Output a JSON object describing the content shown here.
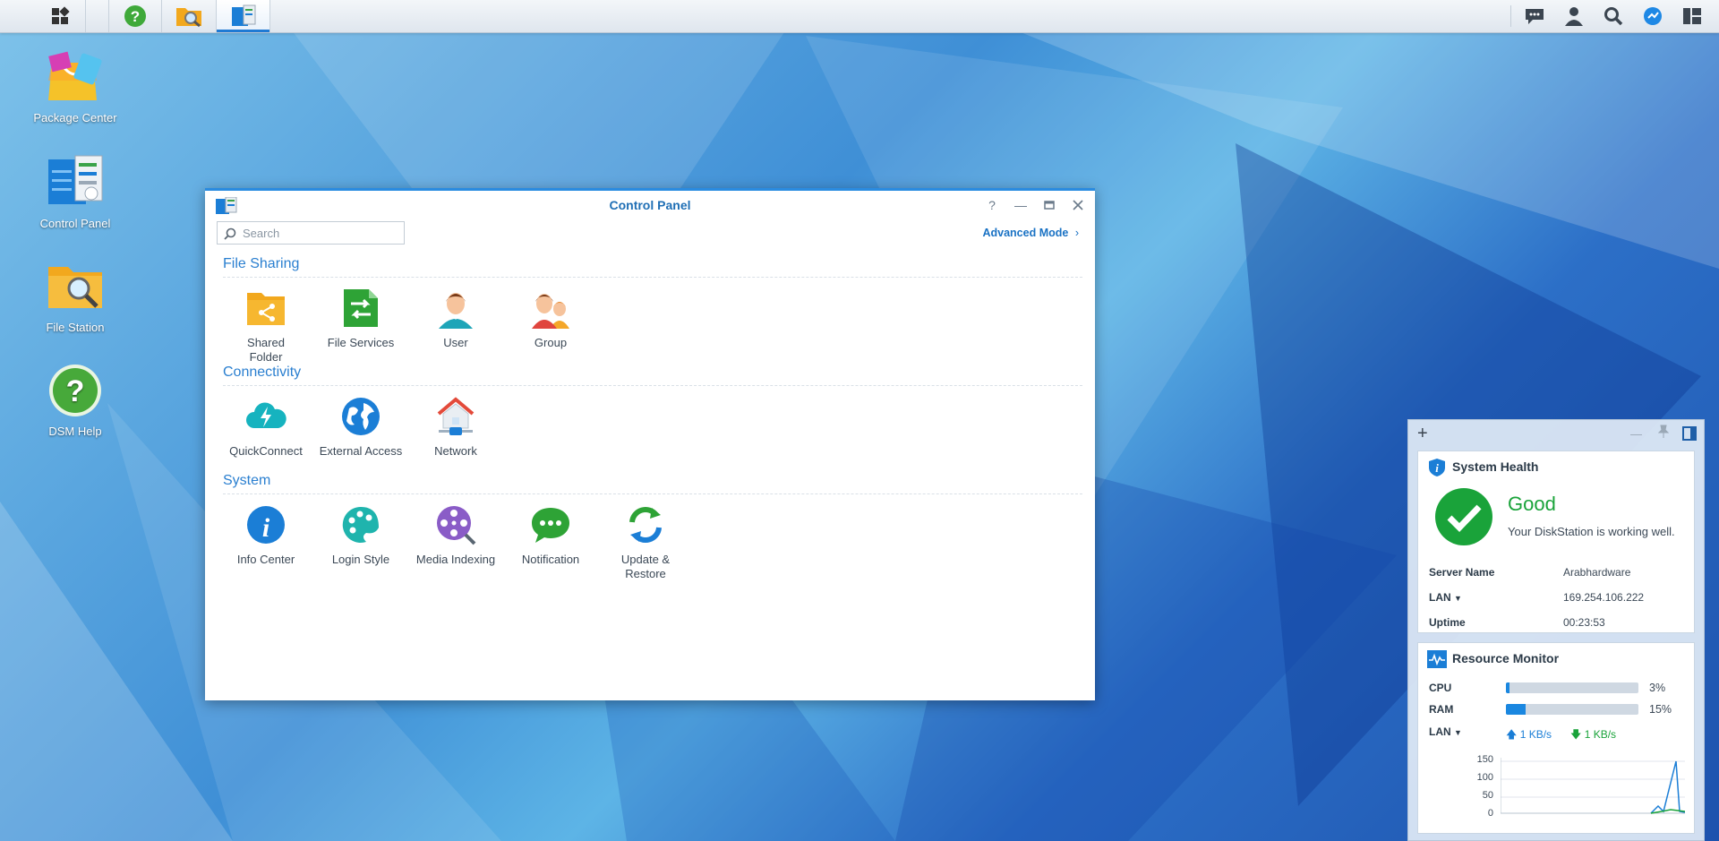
{
  "taskbar": {
    "left": [
      {
        "name": "main-menu-icon"
      },
      {
        "name": "dsm-help-icon"
      },
      {
        "name": "file-station-icon"
      },
      {
        "name": "control-panel-icon"
      }
    ],
    "right": [
      {
        "name": "notifications-icon"
      },
      {
        "name": "user-icon"
      },
      {
        "name": "search-icon"
      },
      {
        "name": "widget-toggle-icon"
      },
      {
        "name": "pilot-view-icon"
      }
    ]
  },
  "desktop": {
    "icons": [
      {
        "label": "Package Center"
      },
      {
        "label": "Control Panel"
      },
      {
        "label": "File Station"
      },
      {
        "label": "DSM Help"
      }
    ]
  },
  "window": {
    "title": "Control Panel",
    "search_placeholder": "Search",
    "advanced_mode": "Advanced Mode",
    "sections": [
      {
        "title": "File Sharing",
        "items": [
          {
            "label": "Shared Folder",
            "icon": "shared-folder-icon"
          },
          {
            "label": "File Services",
            "icon": "file-services-icon"
          },
          {
            "label": "User",
            "icon": "user-icon"
          },
          {
            "label": "Group",
            "icon": "group-icon"
          }
        ]
      },
      {
        "title": "Connectivity",
        "items": [
          {
            "label": "QuickConnect",
            "icon": "quickconnect-icon"
          },
          {
            "label": "External Access",
            "icon": "external-access-icon"
          },
          {
            "label": "Network",
            "icon": "network-icon"
          }
        ]
      },
      {
        "title": "System",
        "items": [
          {
            "label": "Info Center",
            "icon": "info-center-icon"
          },
          {
            "label": "Login Style",
            "icon": "login-style-icon"
          },
          {
            "label": "Media Indexing",
            "icon": "media-indexing-icon"
          },
          {
            "label": "Notification",
            "icon": "notification-icon"
          },
          {
            "label": "Update & Restore",
            "icon": "update-restore-icon"
          }
        ]
      }
    ]
  },
  "widgets": {
    "system_health": {
      "title": "System Health",
      "status": "Good",
      "message": "Your DiskStation is working well.",
      "rows": [
        {
          "key": "Server Name",
          "value": "Arabhardware"
        },
        {
          "key": "LAN",
          "value": "169.254.106.222"
        },
        {
          "key": "Uptime",
          "value": "00:23:53"
        }
      ]
    },
    "resource_monitor": {
      "title": "Resource Monitor",
      "cpu_label": "CPU",
      "cpu_pct": 3,
      "cpu_text": "3%",
      "ram_label": "RAM",
      "ram_pct": 15,
      "ram_text": "15%",
      "lan_label": "LAN",
      "upload": "1 KB/s",
      "download": "1 KB/s",
      "chart_y_ticks": [
        "150",
        "100",
        "50",
        "0"
      ]
    }
  },
  "colors": {
    "accent": "#2a8be0",
    "good": "#1aa33a",
    "title": "#1f6fb5"
  }
}
